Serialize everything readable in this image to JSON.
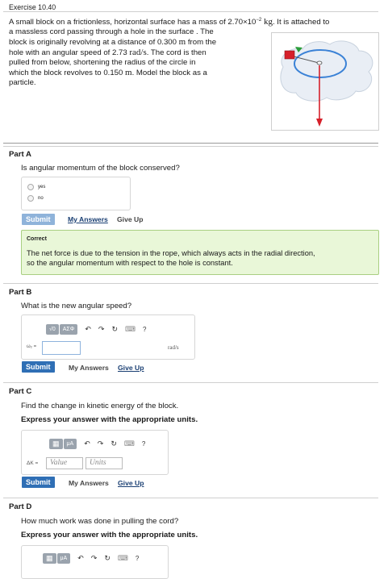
{
  "exercise": {
    "title": "Exercise 10.40",
    "problem_lines": [
      [
        "A small block on a frictionless, horizontal surface has a mass of 2.70×10",
        "−2",
        " kg",
        ". It is attached to"
      ],
      "a massless cord passing through a hole in the surface . The",
      [
        "block is originally revolving at a distance of 0.300 ",
        "m",
        " from the"
      ],
      [
        "hole with an angular speed of 2.73 ",
        "rad/s",
        ". The cord is then"
      ],
      "pulled from below, shortening the radius of the circle in",
      [
        "which the block revolves to 0.150 ",
        "m",
        ". Model the block as a"
      ],
      "particle."
    ]
  },
  "partA": {
    "title": "Part A",
    "question": "Is angular momentum of the block conserved?",
    "options": [
      "yes",
      "no"
    ],
    "submit": "Submit",
    "my_answers": "My Answers",
    "give_up": "Give Up",
    "feedback_title": "Correct",
    "feedback_text_1": "The net force is due to the tension in the rope, which always acts in the radial direction,",
    "feedback_text_2": "so the angular momentum with respect to the hole is constant."
  },
  "partB": {
    "title": "Part B",
    "question": "What is the new angular speed?",
    "toolbar": [
      "√0",
      "ΑΣΦ",
      "↶",
      "↷",
      "↻",
      "⌨",
      "?"
    ],
    "variable": "ω₂ =",
    "unit": "rad/s",
    "submit": "Submit",
    "my_answers": "My Answers",
    "give_up": "Give Up"
  },
  "partC": {
    "title": "Part C",
    "question": "Find the change in kinetic energy of the block.",
    "instruction": "Express your answer with the appropriate units.",
    "toolbar": [
      "▦",
      "μA",
      "↶",
      "↷",
      "↻",
      "⌨",
      "?"
    ],
    "variable": "ΔK =",
    "value_placeholder": "Value",
    "units_placeholder": "Units",
    "submit": "Submit",
    "my_answers": "My Answers",
    "give_up": "Give Up"
  },
  "partD": {
    "title": "Part D",
    "question": "How much work was done in pulling the cord?",
    "instruction": "Express your answer with the appropriate units.",
    "toolbar": [
      "▦",
      "μA",
      "↶",
      "↷",
      "↻",
      "⌨",
      "?"
    ]
  },
  "colors": {
    "submit": "#2f6fb5",
    "correct_bg": "#e9f7d8",
    "arrow": "#d6202a",
    "block": "#d6202a",
    "orbit": "#3b82d6"
  }
}
